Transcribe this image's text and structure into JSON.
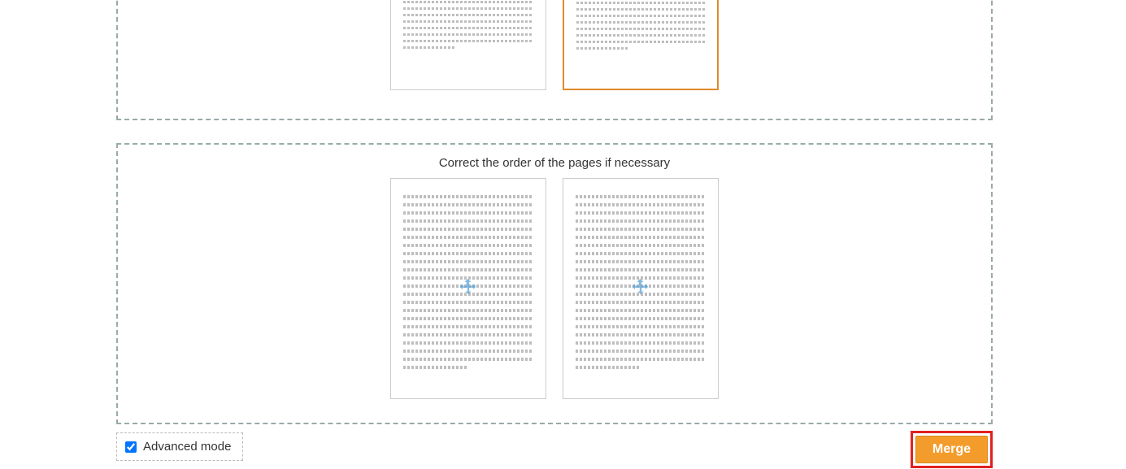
{
  "panel_bottom": {
    "title": "Correct the order of the pages if necessary"
  },
  "controls": {
    "advanced_label": "Advanced mode",
    "advanced_checked": true,
    "merge_label": "Merge"
  },
  "colors": {
    "accent": "#f39c2c",
    "highlight": "#e02020",
    "dash": "#9aa"
  },
  "thumbnails_top": [
    {
      "selected": false
    },
    {
      "selected": true
    }
  ],
  "thumbnails_bottom": [
    {
      "selected": false
    },
    {
      "selected": false
    }
  ]
}
